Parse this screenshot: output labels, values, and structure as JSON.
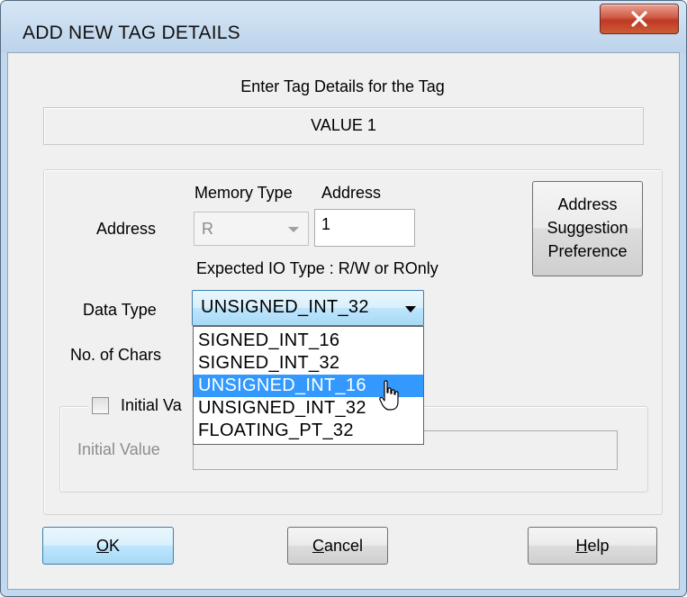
{
  "window": {
    "title": "ADD NEW TAG DETAILS",
    "close_icon": "close-icon"
  },
  "header": {
    "instruction": "Enter Tag Details for the Tag",
    "tag_name": "VALUE 1"
  },
  "address": {
    "label": "Address",
    "memory_type_header": "Memory Type",
    "address_header": "Address",
    "memory_type_value": "R",
    "address_value": "1",
    "suggestion_button": [
      "Address",
      "Suggestion",
      "Preference"
    ],
    "io_type_text": "Expected IO Type : R/W or ROnly"
  },
  "data_type": {
    "label": "Data Type",
    "selected": "UNSIGNED_INT_32",
    "options": [
      "SIGNED_INT_16",
      "SIGNED_INT_32",
      "UNSIGNED_INT_16",
      "UNSIGNED_INT_32",
      "FLOATING_PT_32"
    ],
    "highlighted": "UNSIGNED_INT_16"
  },
  "chars": {
    "label": "No. of Chars"
  },
  "initial_value": {
    "checkbox_label": "Initial Va",
    "field_label": "Initial Value",
    "checked": false
  },
  "buttons": {
    "ok_accel": "O",
    "ok_rest": "K",
    "cancel_accel": "C",
    "cancel_rest": "ancel",
    "help_accel": "H",
    "help_rest": "elp"
  },
  "colors": {
    "selection": "#3399ff",
    "focus_border": "#3c7fb1",
    "dialog_bg": "#f0f0f0",
    "close_button": "#c7442c"
  }
}
